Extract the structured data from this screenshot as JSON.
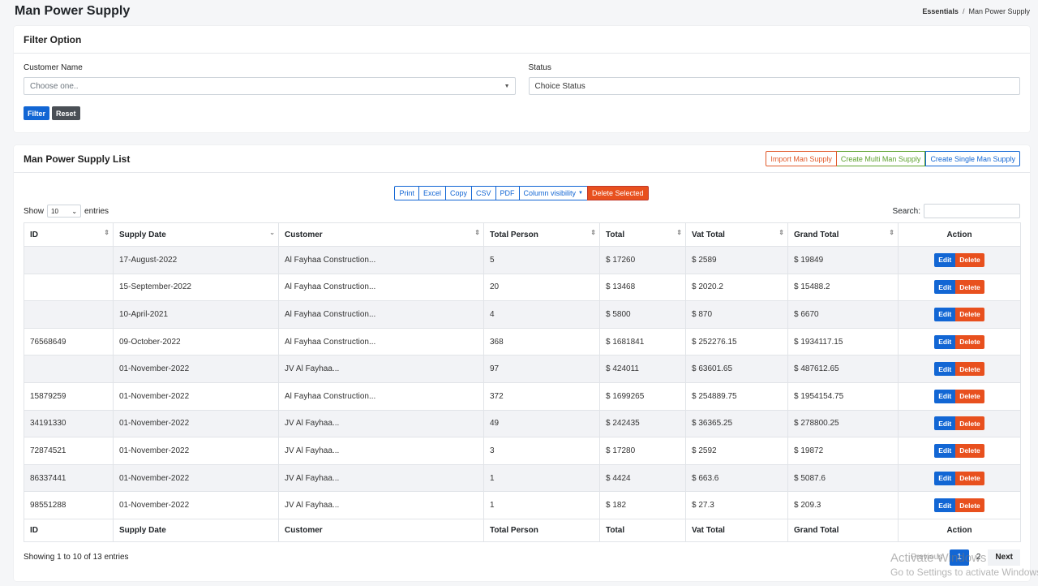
{
  "page": {
    "title": "Man Power Supply"
  },
  "breadcrumb": {
    "first": "Essentials",
    "separator": "/",
    "current": "Man Power Supply"
  },
  "filter": {
    "title": "Filter Option",
    "customer_label": "Customer Name",
    "customer_value": "Choose one..",
    "status_label": "Status",
    "status_value": "Choice Status",
    "filter_btn": "Filter",
    "reset_btn": "Reset"
  },
  "list": {
    "title": "Man Power Supply List",
    "import_btn": "Import Man Supply",
    "multi_btn": "Create Multi Man Supply",
    "single_btn": "Create Single Man Supply"
  },
  "dt_buttons": {
    "print": "Print",
    "excel": "Excel",
    "copy": "Copy",
    "csv": "CSV",
    "pdf": "PDF",
    "colvis": "Column visibility",
    "delete_selected": "Delete Selected"
  },
  "length": {
    "show": "Show",
    "value": "10",
    "entries": "entries"
  },
  "search": {
    "label": "Search:"
  },
  "table": {
    "headers": [
      "ID",
      "Supply Date",
      "Customer",
      "Total Person",
      "Total",
      "Vat Total",
      "Grand Total",
      "Action"
    ],
    "rows": [
      [
        "",
        "17-August-2022",
        "Al Fayhaa Construction...",
        "5",
        "$ 17260",
        "$ 2589",
        "$ 19849"
      ],
      [
        "",
        "15-September-2022",
        "Al Fayhaa Construction...",
        "20",
        "$ 13468",
        "$ 2020.2",
        "$ 15488.2"
      ],
      [
        "",
        "10-April-2021",
        "Al Fayhaa Construction...",
        "4",
        "$ 5800",
        "$ 870",
        "$ 6670"
      ],
      [
        "76568649",
        "09-October-2022",
        "Al Fayhaa Construction...",
        "368",
        "$ 1681841",
        "$ 252276.15",
        "$ 1934117.15"
      ],
      [
        "",
        "01-November-2022",
        "JV Al Fayhaa...",
        "97",
        "$ 424011",
        "$ 63601.65",
        "$ 487612.65"
      ],
      [
        "15879259",
        "01-November-2022",
        "Al Fayhaa Construction...",
        "372",
        "$ 1699265",
        "$ 254889.75",
        "$ 1954154.75"
      ],
      [
        "34191330",
        "01-November-2022",
        "JV Al Fayhaa...",
        "49",
        "$ 242435",
        "$ 36365.25",
        "$ 278800.25"
      ],
      [
        "72874521",
        "01-November-2022",
        "JV Al Fayhaa...",
        "3",
        "$ 17280",
        "$ 2592",
        "$ 19872"
      ],
      [
        "86337441",
        "01-November-2022",
        "JV Al Fayhaa...",
        "1",
        "$ 4424",
        "$ 663.6",
        "$ 5087.6"
      ],
      [
        "98551288",
        "01-November-2022",
        "JV Al Fayhaa...",
        "1",
        "$ 182",
        "$ 27.3",
        "$ 209.3"
      ]
    ],
    "edit_label": "Edit",
    "delete_label": "Delete"
  },
  "footer": {
    "info": "Showing 1 to 10 of 13 entries",
    "previous": "Previous",
    "pages": [
      "1",
      "2"
    ],
    "next": "Next"
  },
  "watermark": {
    "line1": "Activate Windows",
    "line2": "Go to Settings to activate Windows."
  },
  "colors": {
    "primary": "#1266d4",
    "danger": "#e8501e",
    "success": "#5da22e",
    "dark": "#4a4f55"
  }
}
